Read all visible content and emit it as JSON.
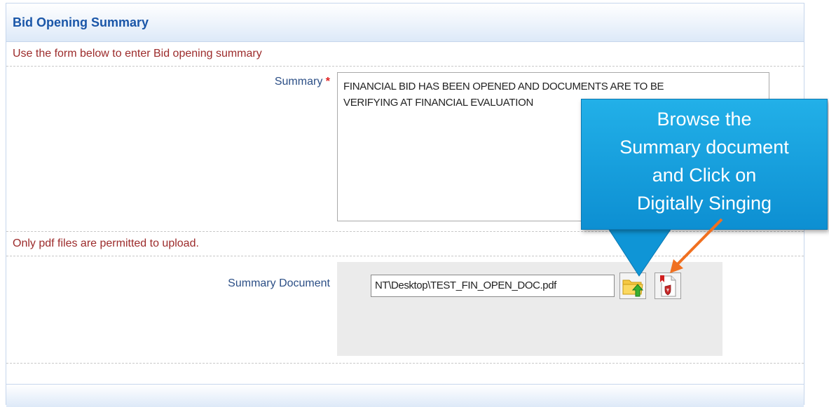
{
  "header": {
    "title": "Bid Opening Summary"
  },
  "form": {
    "intro": "Use the form below to enter Bid opening summary",
    "summary": {
      "label": "Summary",
      "required_mark": "*",
      "line1": "FINANCIAL BID HAS BEEN OPENED AND DOCUMENTS ARE TO BE",
      "line2": "VERIFYING AT FINANCIAL EVALUATION"
    },
    "upload_note": "Only pdf files are permitted to upload.",
    "document": {
      "label": "Summary Document",
      "file_path": "NT\\Desktop\\TEST_FIN_OPEN_DOC.pdf"
    }
  },
  "icons": {
    "browse": "folder-upload-icon",
    "sign": "digital-sign-icon"
  },
  "callout": {
    "line1": "Browse the",
    "line2": "Summary document",
    "line3": "and Click on",
    "line4": "Digitally Singing"
  },
  "colors": {
    "header_text": "#1a56a8",
    "note_text": "#9c2b2b",
    "callout_bg": "#1aa3e2",
    "arrow": "#f07020"
  }
}
